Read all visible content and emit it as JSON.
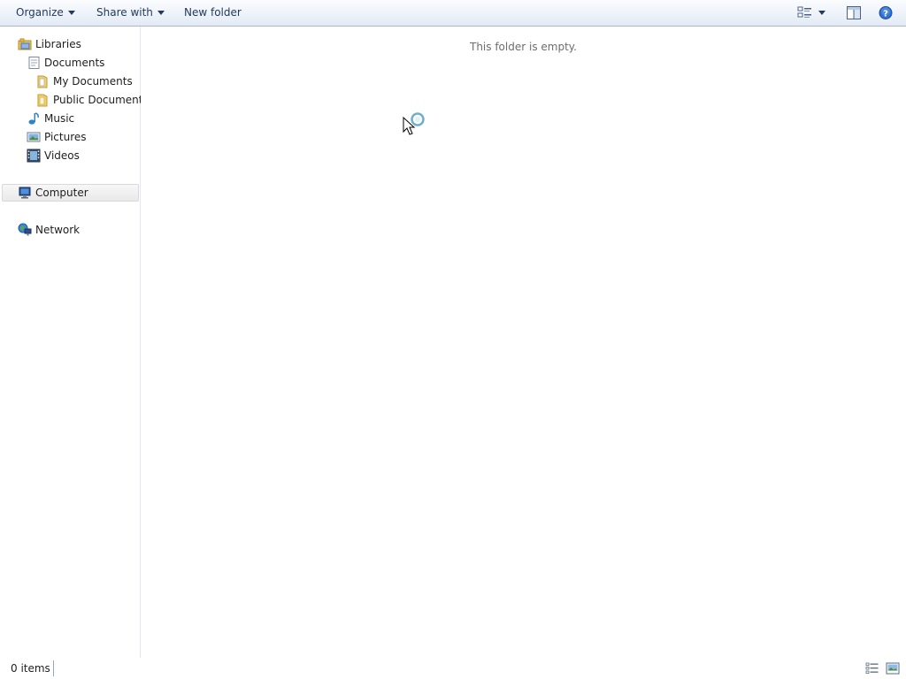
{
  "toolbar": {
    "organize_label": "Organize",
    "share_with_label": "Share with",
    "new_folder_label": "New folder",
    "icons": [
      "change-view-icon",
      "view-options-caret-icon",
      "preview-pane-icon",
      "help-icon"
    ]
  },
  "sidebar": {
    "libraries": "Libraries",
    "documents": "Documents",
    "my_documents": "My Documents",
    "public_documents": "Public Documents",
    "music": "Music",
    "pictures": "Pictures",
    "videos": "Videos",
    "computer": "Computer",
    "network": "Network"
  },
  "content": {
    "empty_message": "This folder is empty."
  },
  "status": {
    "item_count": "0 items"
  },
  "colors": {
    "toolbar_text": "#1e395b",
    "empty_text": "#6d6d6d",
    "selection_bg": "#e9e9e9"
  }
}
